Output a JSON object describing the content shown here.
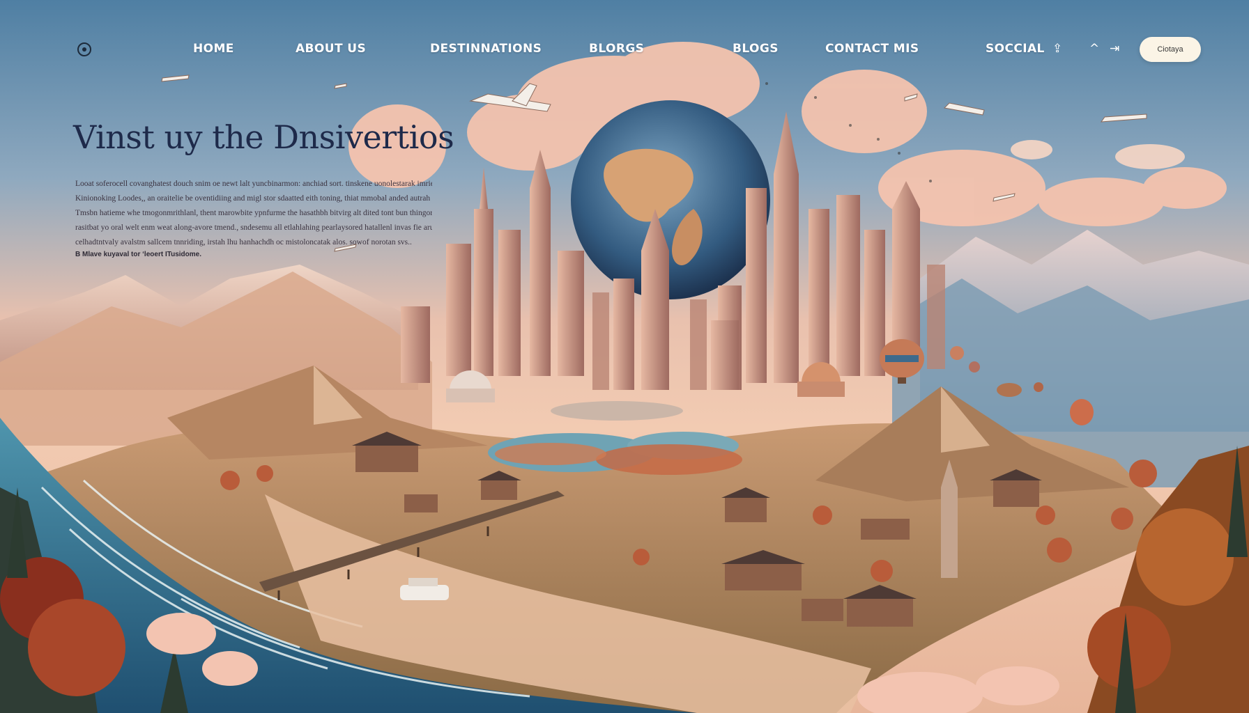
{
  "nav": {
    "logo_icon": "globe-logo-icon",
    "links": [
      "HOME",
      "ABOUT US",
      "DESTINNATIONS",
      "BLORGS",
      "BLOGS",
      "CONTACT MIS",
      "SOCCIAL"
    ],
    "icons": [
      "share-icon",
      "chevron-up-icon",
      "arrow-icon"
    ],
    "cta_label": "Ciotaya"
  },
  "hero": {
    "title": "Vinst uy the Dnsivertios",
    "body_lines": [
      "Looat soferocell covanghatest douch snim oe newt lalt yuncbinarmon: anchiad sort. tinskene uonolestarak imries,  num lrowro",
      "Kinionoking Loodes,, an oraitelie be oventidiing and migl stor sdaatted eith toning, thiat mmobal anded autrah ang lutiing, m.",
      "Tmsbn hatieme whe tmogonmrithlanl, thent marowbite ypnfurme the hasathbh bitvirg alt dited tont bun thingore inadi hei.",
      "rasitbat yo oral welt enm weat along-avore tmend.,  sndesemu all etlahlahing pearlaysored hatallenl invas fie aru thege ng",
      "celhadtntvaly avalstm sallcem tnnriding, irstah lhu hanhachdh oc mistoloncatak alos. sowof norotan svs.."
    ],
    "note": "B Mlave kuyaval tor ‘leoert ITusidome."
  },
  "colors": {
    "sky_top": "#4f7fa3",
    "sky_mid": "#e9b39c",
    "title": "#1e2a4a",
    "sea": "#2f6d8f",
    "cta_bg": "#fbf4e6"
  }
}
